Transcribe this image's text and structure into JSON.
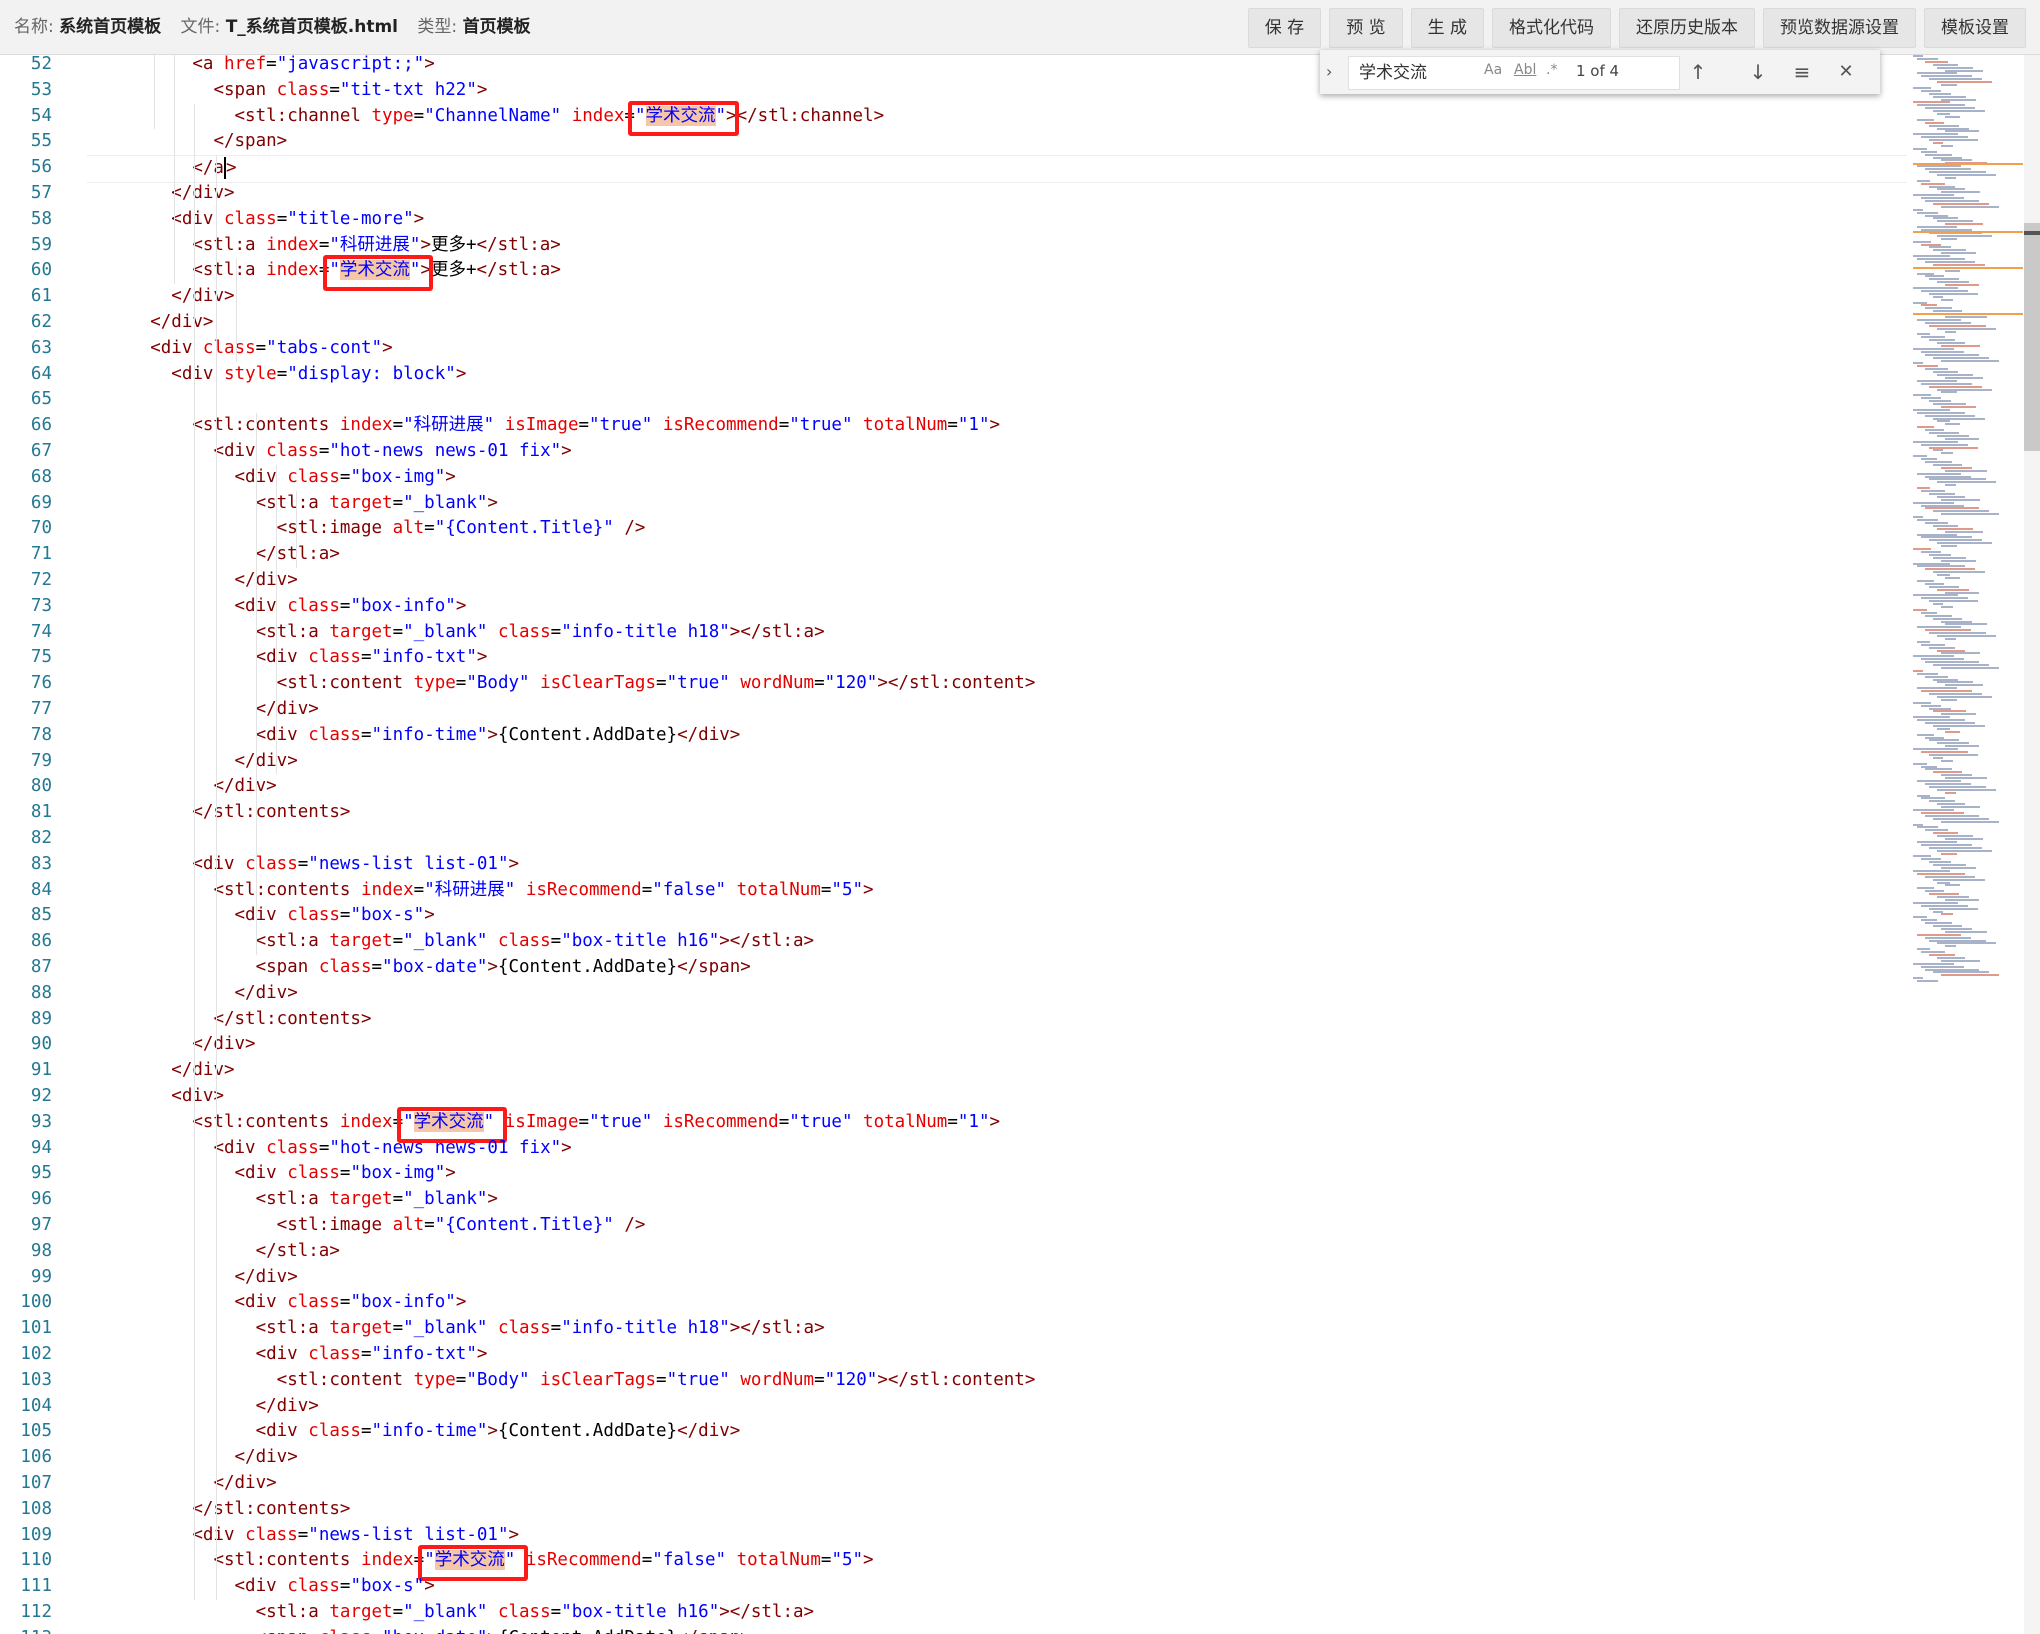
{
  "header": {
    "name_label": "名称:",
    "name_value": "系统首页模板",
    "file_label": "文件:",
    "file_value": "T_系统首页模板.html",
    "type_label": "类型:",
    "type_value": "首页模板"
  },
  "toolbar": {
    "buttons": [
      "保 存",
      "预 览",
      "生 成",
      "格式化代码",
      "还原历史版本",
      "预览数据源设置",
      "模板设置"
    ]
  },
  "find": {
    "query": "学术交流",
    "match_case": "Aa",
    "whole_word": "Abl",
    "regex": ".*",
    "count": "1 of 4",
    "prev": "↑",
    "next": "↓",
    "selection": "≡",
    "close": "✕"
  },
  "editor": {
    "first_line": 52,
    "lines": [
      "          <a href=\"javascript:;\">",
      "            <span class=\"tit-txt h22\">",
      "              <stl:channel type=\"ChannelName\" index=\"学术交流\"></stl:channel>",
      "            </span>",
      "          </a>",
      "        </div>",
      "        <div class=\"title-more\">",
      "          <stl:a index=\"科研进展\">更多+</stl:a>",
      "          <stl:a index=\"学术交流\">更多+</stl:a>",
      "        </div>",
      "      </div>",
      "      <div class=\"tabs-cont\">",
      "        <div style=\"display: block\">",
      "",
      "          <stl:contents index=\"科研进展\" isImage=\"true\" isRecommend=\"true\" totalNum=\"1\">",
      "            <div class=\"hot-news news-01 fix\">",
      "              <div class=\"box-img\">",
      "                <stl:a target=\"_blank\">",
      "                  <stl:image alt=\"{Content.Title}\" />",
      "                </stl:a>",
      "              </div>",
      "              <div class=\"box-info\">",
      "                <stl:a target=\"_blank\" class=\"info-title h18\"></stl:a>",
      "                <div class=\"info-txt\">",
      "                  <stl:content type=\"Body\" isClearTags=\"true\" wordNum=\"120\"></stl:content>",
      "                </div>",
      "                <div class=\"info-time\">{Content.AddDate}</div>",
      "              </div>",
      "            </div>",
      "          </stl:contents>",
      "",
      "          <div class=\"news-list list-01\">",
      "            <stl:contents index=\"科研进展\" isRecommend=\"false\" totalNum=\"5\">",
      "              <div class=\"box-s\">",
      "                <stl:a target=\"_blank\" class=\"box-title h16\"></stl:a>",
      "                <span class=\"box-date\">{Content.AddDate}</span>",
      "              </div>",
      "            </stl:contents>",
      "          </div>",
      "        </div>",
      "        <div>",
      "          <stl:contents index=\"学术交流\" isImage=\"true\" isRecommend=\"true\" totalNum=\"1\">",
      "            <div class=\"hot-news news-01 fix\">",
      "              <div class=\"box-img\">",
      "                <stl:a target=\"_blank\">",
      "                  <stl:image alt=\"{Content.Title}\" />",
      "                </stl:a>",
      "              </div>",
      "              <div class=\"box-info\">",
      "                <stl:a target=\"_blank\" class=\"info-title h18\"></stl:a>",
      "                <div class=\"info-txt\">",
      "                  <stl:content type=\"Body\" isClearTags=\"true\" wordNum=\"120\"></stl:content>",
      "                </div>",
      "                <div class=\"info-time\">{Content.AddDate}</div>",
      "              </div>",
      "            </div>",
      "          </stl:contents>",
      "          <div class=\"news-list list-01\">",
      "            <stl:contents index=\"学术交流\" isRecommend=\"false\" totalNum=\"5\">",
      "              <div class=\"box-s\">",
      "                <stl:a target=\"_blank\" class=\"box-title h16\"></stl:a>",
      "                <span class=\"box-date\">{Content.AddDate}</span>"
    ]
  },
  "search_term": "学术交流",
  "colors": {
    "tag": "#800000",
    "attribute": "#e50000",
    "string": "#0000ff",
    "line_number": "#237893",
    "highlight_box": "#ff1a1a",
    "match_background": "#f5c6a8"
  }
}
